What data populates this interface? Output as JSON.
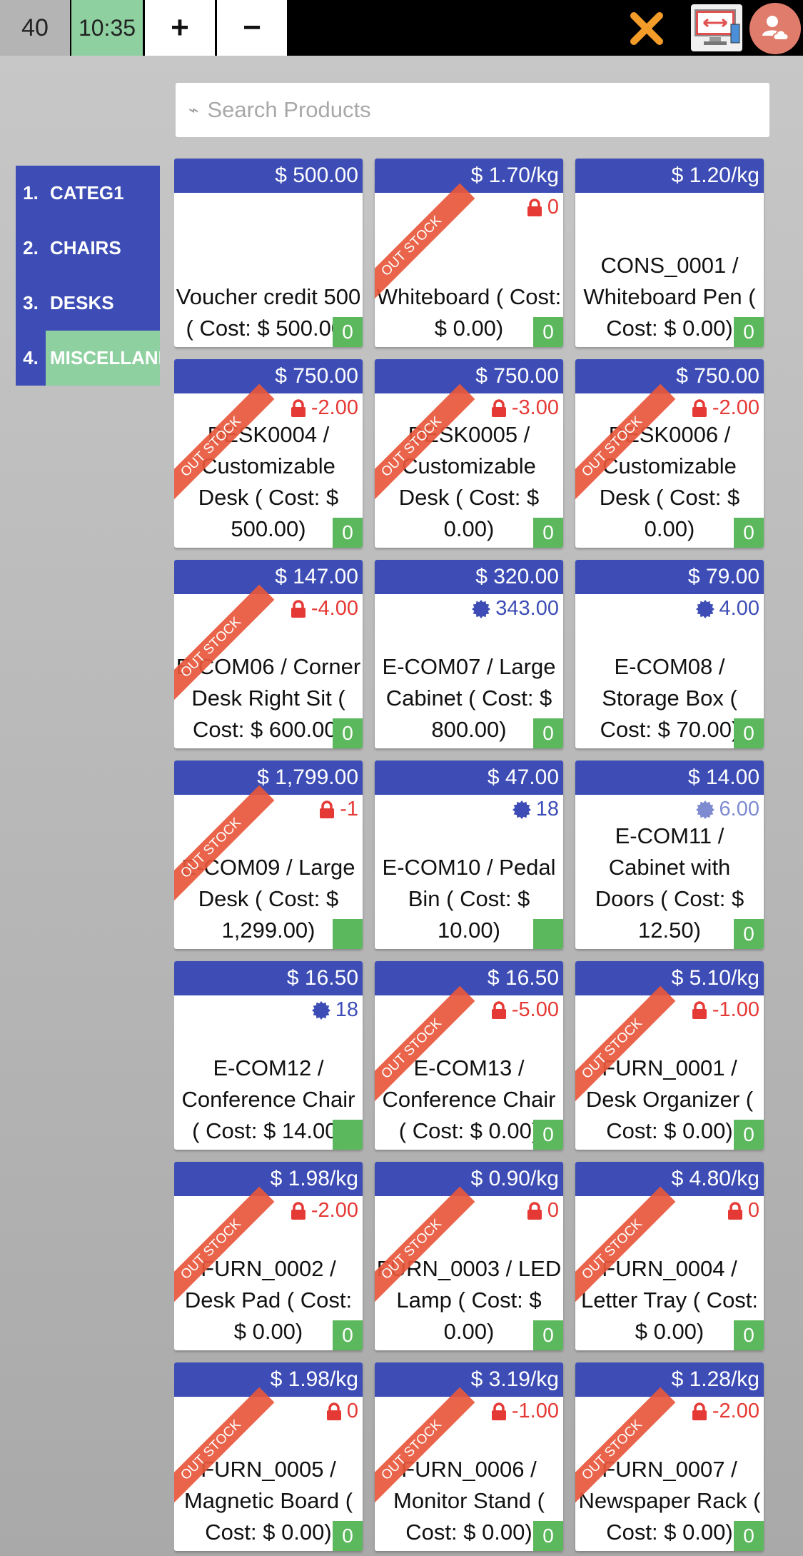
{
  "topbar": {
    "order_count": "40",
    "time": "10:35",
    "plus_label": "+",
    "minus_label": "−",
    "close_icon": "close-x-icon",
    "sync_icon": "screen-transfer-icon",
    "cloud_icon": "cloud-user-icon",
    "accent_close": "#f39c29"
  },
  "search": {
    "placeholder": "Search Products"
  },
  "categories": [
    {
      "num": "1.",
      "label": "CATEG1",
      "active": false
    },
    {
      "num": "2.",
      "label": "CHAIRS",
      "active": false
    },
    {
      "num": "3.",
      "label": "DESKS",
      "active": false
    },
    {
      "num": "4.",
      "label": "MISCELLANEOUS",
      "active": true
    }
  ],
  "colors": {
    "header": "#3d4db5",
    "qty": "#5cb85c",
    "negative": "#e53935",
    "ribbon": "#e8573b",
    "active_category": "#8fd0a0"
  },
  "ribbon_label": "OUT STOCK",
  "products": [
    {
      "price": "$ 500.00",
      "stock": "",
      "stock_icon": "",
      "name": "Voucher credit 500 ( Cost: $ 500.00)",
      "qty": "0",
      "out": false
    },
    {
      "price": "$ 1.70/kg",
      "stock": "0",
      "stock_icon": "lock",
      "name": "Whiteboard ( Cost: $ 0.00)",
      "qty": "0",
      "out": true
    },
    {
      "price": "$ 1.20/kg",
      "stock": "",
      "stock_icon": "",
      "name": "CONS_0001 / Whiteboard Pen ( Cost: $ 0.00)",
      "qty": "0",
      "out": false
    },
    {
      "price": "$ 750.00",
      "stock": "-2.00",
      "stock_icon": "lock",
      "name": "DESK0004 / Customizable Desk ( Cost: $ 500.00)",
      "qty": "0",
      "out": true
    },
    {
      "price": "$ 750.00",
      "stock": "-3.00",
      "stock_icon": "lock",
      "name": "DESK0005 / Customizable Desk ( Cost: $ 0.00)",
      "qty": "0",
      "out": true
    },
    {
      "price": "$ 750.00",
      "stock": "-2.00",
      "stock_icon": "lock",
      "name": "DESK0006 / Customizable Desk ( Cost: $ 0.00)",
      "qty": "0",
      "out": true
    },
    {
      "price": "$ 147.00",
      "stock": "-4.00",
      "stock_icon": "lock",
      "name": "E-COM06 / Corner Desk Right Sit ( Cost: $ 600.00)",
      "qty": "0",
      "out": true
    },
    {
      "price": "$ 320.00",
      "stock": "343.00",
      "stock_icon": "badge",
      "name": "E-COM07 / Large Cabinet ( Cost: $ 800.00)",
      "qty": "0",
      "out": false
    },
    {
      "price": "$ 79.00",
      "stock": "4.00",
      "stock_icon": "badge",
      "name": "E-COM08 / Storage Box ( Cost: $ 70.00)",
      "qty": "0",
      "out": false
    },
    {
      "price": "$ 1,799.00",
      "stock": "-1",
      "stock_icon": "lock",
      "name": "E-COM09 / Large Desk ( Cost: $ 1,299.00)",
      "qty": "",
      "out": true
    },
    {
      "price": "$ 47.00",
      "stock": "18",
      "stock_icon": "badge",
      "name": "E-COM10 / Pedal Bin ( Cost: $ 10.00)",
      "qty": "",
      "out": false
    },
    {
      "price": "$ 14.00",
      "stock": "6.00",
      "stock_icon": "badge-faint",
      "name": "E-COM11 / Cabinet with Doors ( Cost: $ 12.50)",
      "qty": "0",
      "out": false
    },
    {
      "price": "$ 16.50",
      "stock": "18",
      "stock_icon": "badge",
      "name": "E-COM12 / Conference Chair ( Cost: $ 14.00)",
      "qty": "",
      "out": false
    },
    {
      "price": "$ 16.50",
      "stock": "-5.00",
      "stock_icon": "lock",
      "name": "E-COM13 / Conference Chair ( Cost: $ 0.00)",
      "qty": "0",
      "out": true
    },
    {
      "price": "$ 5.10/kg",
      "stock": "-1.00",
      "stock_icon": "lock",
      "name": "FURN_0001 / Desk Organizer ( Cost: $ 0.00)",
      "qty": "0",
      "out": true
    },
    {
      "price": "$ 1.98/kg",
      "stock": "-2.00",
      "stock_icon": "lock",
      "name": "FURN_0002 / Desk Pad ( Cost: $ 0.00)",
      "qty": "0",
      "out": true
    },
    {
      "price": "$ 0.90/kg",
      "stock": "0",
      "stock_icon": "lock",
      "name": "FURN_0003 / LED Lamp ( Cost: $ 0.00)",
      "qty": "0",
      "out": true
    },
    {
      "price": "$ 4.80/kg",
      "stock": "0",
      "stock_icon": "lock",
      "name": "FURN_0004 / Letter Tray ( Cost: $ 0.00)",
      "qty": "0",
      "out": true
    },
    {
      "price": "$ 1.98/kg",
      "stock": "0",
      "stock_icon": "lock",
      "name": "FURN_0005 / Magnetic Board ( Cost: $ 0.00)",
      "qty": "0",
      "out": true
    },
    {
      "price": "$ 3.19/kg",
      "stock": "-1.00",
      "stock_icon": "lock",
      "name": "FURN_0006 / Monitor Stand ( Cost: $ 0.00)",
      "qty": "0",
      "out": true
    },
    {
      "price": "$ 1.28/kg",
      "stock": "-2.00",
      "stock_icon": "lock",
      "name": "FURN_0007 / Newspaper Rack ( Cost: $ 0.00)",
      "qty": "0",
      "out": true
    }
  ]
}
